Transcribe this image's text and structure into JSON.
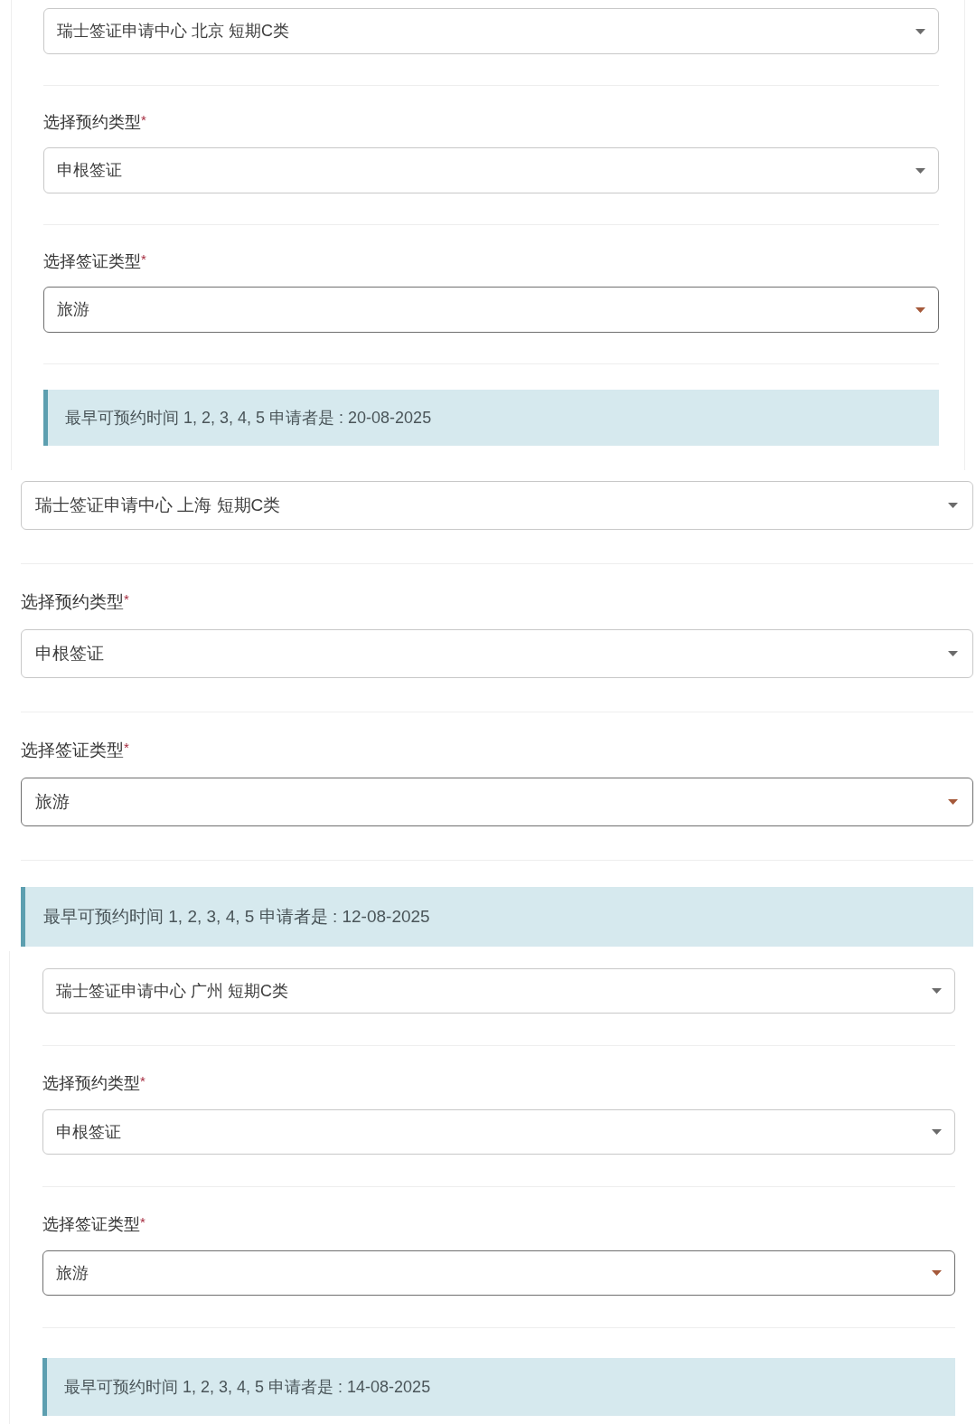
{
  "panels": [
    {
      "fields": [
        {
          "value": "瑞士签证申请中心 北京 短期C类",
          "focused": false
        },
        {
          "label": "选择预约类型",
          "required_mark": "*",
          "value": "申根签证",
          "focused": false
        },
        {
          "label": "选择签证类型",
          "required_mark": "*",
          "value": "旅游",
          "focused": true
        }
      ],
      "notice": "最早可预约时间 1, 2, 3, 4, 5 申请者是 : 20-08-2025"
    },
    {
      "fields": [
        {
          "value": "瑞士签证申请中心 上海 短期C类",
          "focused": false
        },
        {
          "label": "选择预约类型",
          "required_mark": "*",
          "value": "申根签证",
          "focused": false
        },
        {
          "label": "选择签证类型",
          "required_mark": "*",
          "value": "旅游",
          "focused": true
        }
      ],
      "notice": "最早可预约时间 1, 2, 3, 4, 5 申请者是 : 12-08-2025"
    },
    {
      "fields": [
        {
          "value": "瑞士签证申请中心 广州 短期C类",
          "focused": false
        },
        {
          "label": "选择预约类型",
          "required_mark": "*",
          "value": "申根签证",
          "focused": false
        },
        {
          "label": "选择签证类型",
          "required_mark": "*",
          "value": "旅游",
          "focused": true
        }
      ],
      "notice": "最早可预约时间 1, 2, 3, 4, 5 申请者是 : 14-08-2025"
    }
  ]
}
